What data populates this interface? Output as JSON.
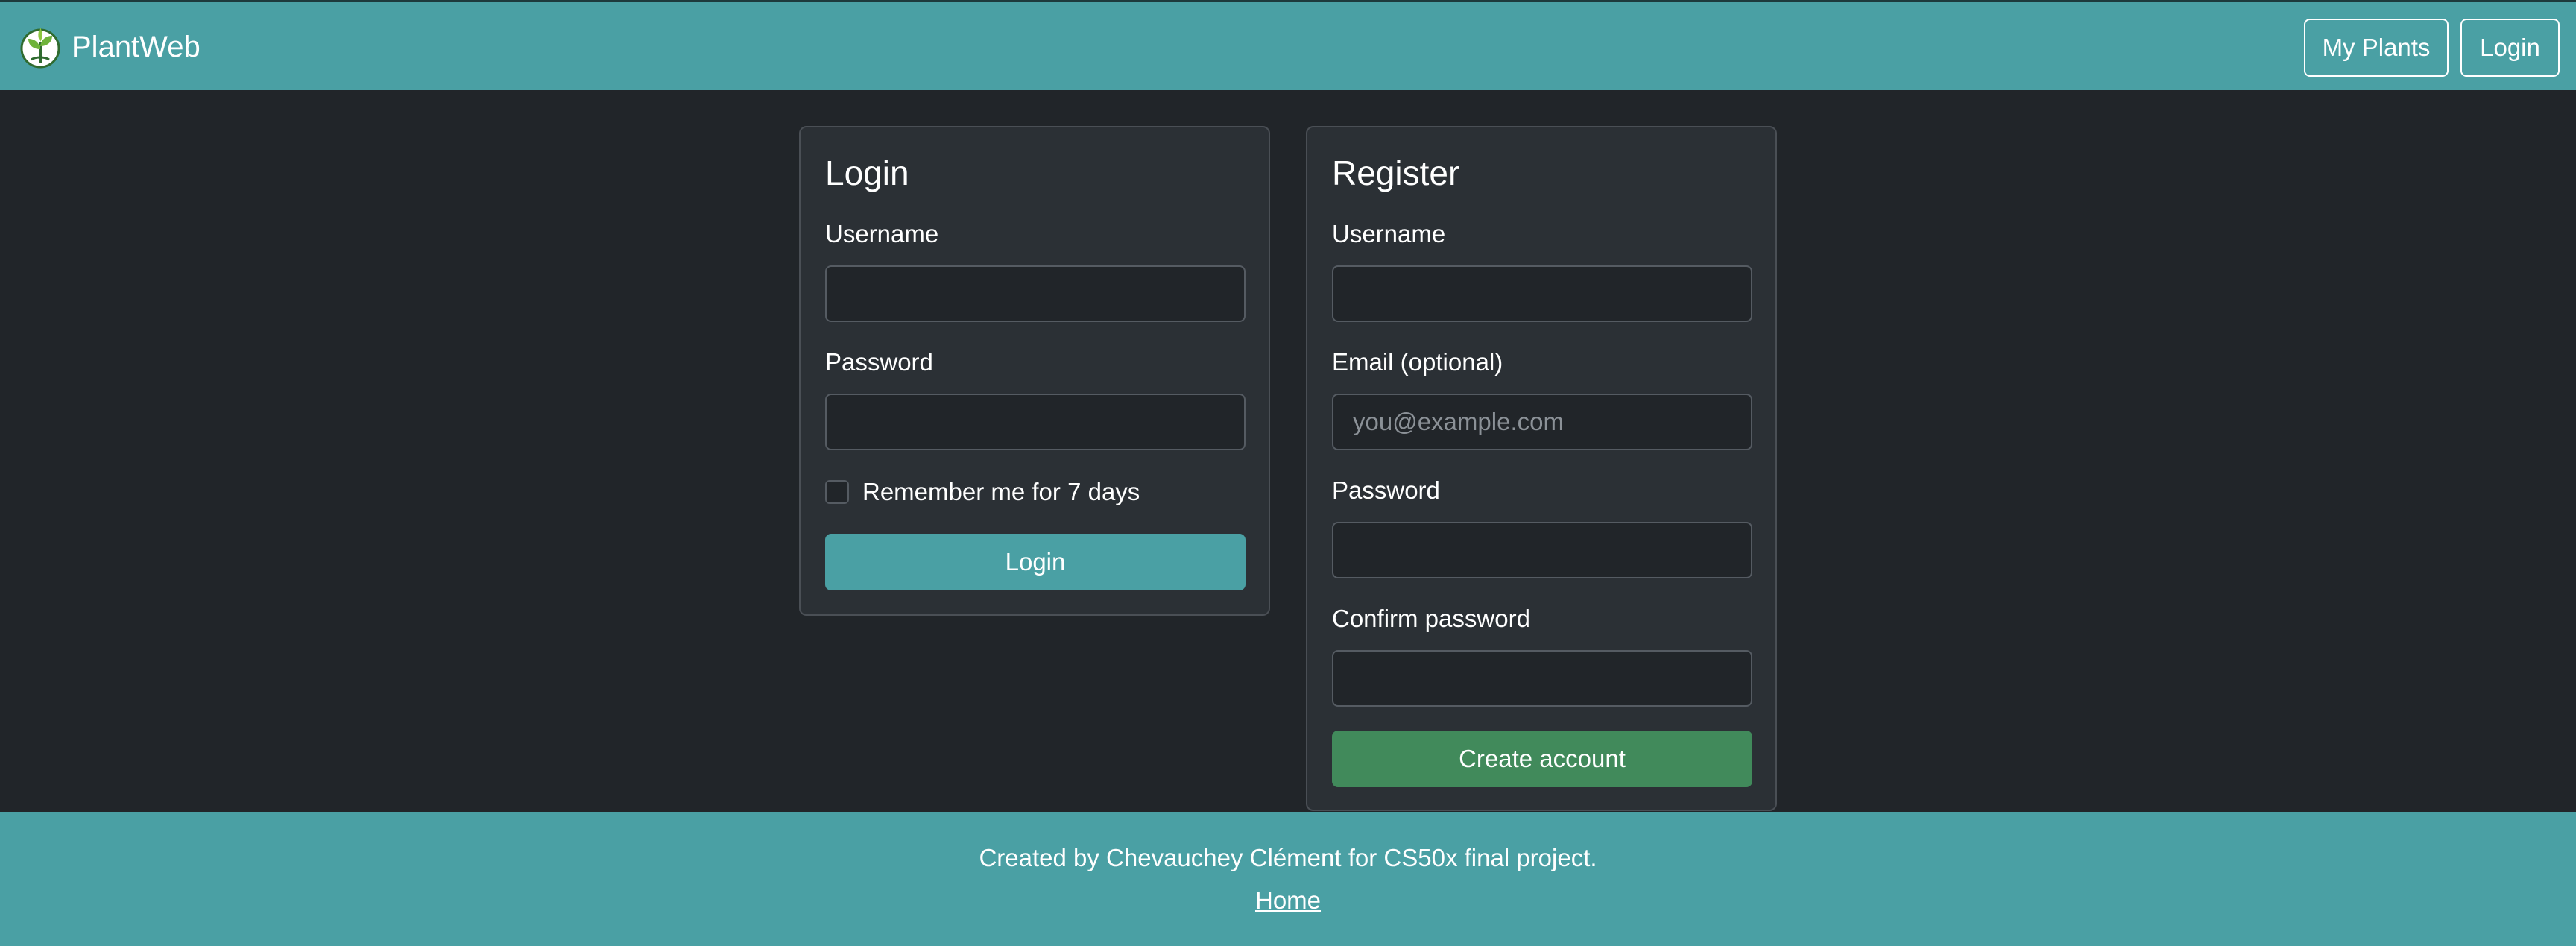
{
  "navbar": {
    "brand": "PlantWeb",
    "logo_icon": "plant-logo-icon",
    "links": {
      "my_plants": "My Plants",
      "login": "Login"
    },
    "color": "#4aa0a4"
  },
  "login_form": {
    "title": "Login",
    "username_label": "Username",
    "username_value": "",
    "password_label": "Password",
    "password_value": "",
    "remember_label": "Remember me for 7 days",
    "remember_checked": false,
    "submit_label": "Login"
  },
  "register_form": {
    "title": "Register",
    "username_label": "Username",
    "username_value": "",
    "email_label": "Email (optional)",
    "email_placeholder": "you@example.com",
    "password_label": "Password",
    "password_value": "",
    "confirm_label": "Confirm password",
    "confirm_value": "",
    "submit_label": "Create account",
    "submit_color": "#418a5b"
  },
  "footer": {
    "credit": "Created by Chevauchey Clément for CS50x final project.",
    "home_link": "Home"
  },
  "colors": {
    "background": "#212529",
    "card": "#2b3035",
    "accent": "#4aa0a4",
    "success": "#418a5b"
  }
}
